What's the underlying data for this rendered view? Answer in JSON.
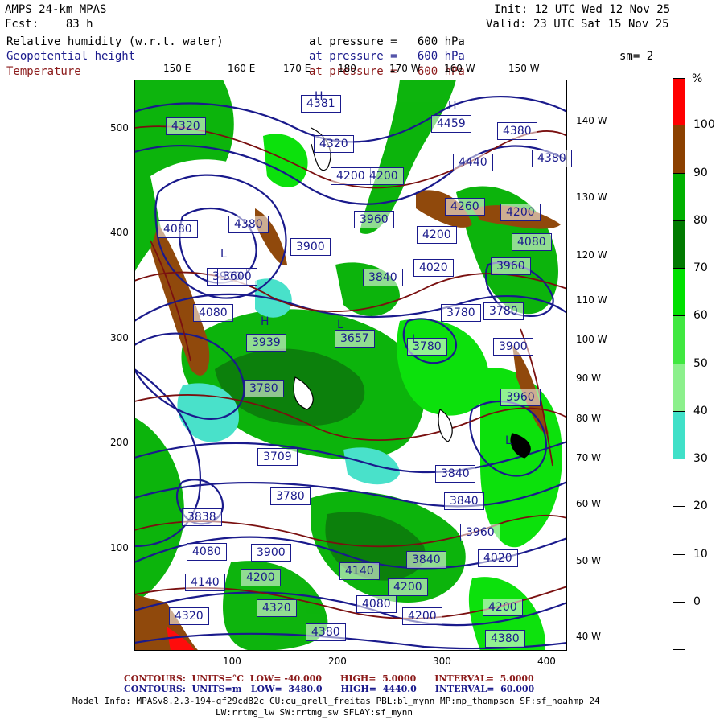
{
  "header": {
    "model": "AMPS 24-km MPAS",
    "forecast": "Fcst:    83 h",
    "init": "Init: 12 UTC Wed 12 Nov 25",
    "valid": "Valid: 23 UTC Sat 15 Nov 25",
    "field1": "Relative humidity (w.r.t. water)",
    "field1_level": "at pressure =   600 hPa",
    "field2": "Geopotential height",
    "field2_level": "at pressure =   600 hPa",
    "field3": "Temperature",
    "field3_level": "at pressure =   600 hPa",
    "smoothing": "sm= 2"
  },
  "lon_top": [
    "150 E",
    "160 E",
    "170 E",
    "180",
    "170 W",
    "160 W",
    "150 W"
  ],
  "lon_right": [
    "140 W",
    "130 W",
    "120 W",
    "110 W",
    "100 W",
    "90 W",
    "80 W",
    "70 W",
    "60 W",
    "50 W",
    "40 W"
  ],
  "x_ticks": [
    "100",
    "200",
    "300",
    "400"
  ],
  "y_ticks": [
    "500",
    "400",
    "300",
    "200",
    "100"
  ],
  "colorbar": {
    "unit": "%",
    "labels": [
      "100",
      "90",
      "80",
      "70",
      "60",
      "50",
      "40",
      "30",
      "20",
      "10",
      "0"
    ],
    "colors": [
      "#ff0000",
      "#8b4000",
      "#00b000",
      "#007a00",
      "#00e000",
      "#40e840",
      "#8cf08c",
      "#40e0c8",
      "#ffffff",
      "#ffffff",
      "#ffffff",
      "#ffffff"
    ]
  },
  "height_labels": [
    "4381",
    "4320",
    "4459",
    "4380",
    "4440",
    "4380",
    "4320",
    "4200",
    "4200",
    "4260",
    "4200",
    "4080",
    "4380",
    "3960",
    "4200",
    "4080",
    "3900",
    "3900",
    "3840",
    "4020",
    "3960",
    "3600",
    "4080",
    "3780",
    "3780",
    "3939",
    "3657",
    "3900",
    "3780",
    "3960",
    "3780",
    "3709",
    "3840",
    "3780",
    "3840",
    "3838",
    "3960",
    "4080",
    "3900",
    "3840",
    "4020",
    "4140",
    "4200",
    "4140",
    "4200",
    "4080",
    "4200",
    "4320",
    "4320",
    "4380",
    "4200",
    "4380"
  ],
  "pressure_centers": [
    "H",
    "H",
    "H",
    "L",
    "L",
    "L",
    "L"
  ],
  "footer": {
    "line1_label": "CONTOURS:  UNITS=°C  LOW= -40.000      HIGH=  5.0000      INTERVAL=  5.0000",
    "line2_label": "CONTOURS:  UNITS=m   LOW=  3480.0      HIGH=  4440.0      INTERVAL=  60.000",
    "model_info": "Model Info: MPASv8.2.3-194-gf29cd82c CU:cu_grell_freitas PBL:bl_mynn MP:mp_thompson SF:sf_noahmp 24",
    "model_info2": "LW:rrtmg_lw SW:rrtmg_sw SFLAY:sf_mynn"
  }
}
